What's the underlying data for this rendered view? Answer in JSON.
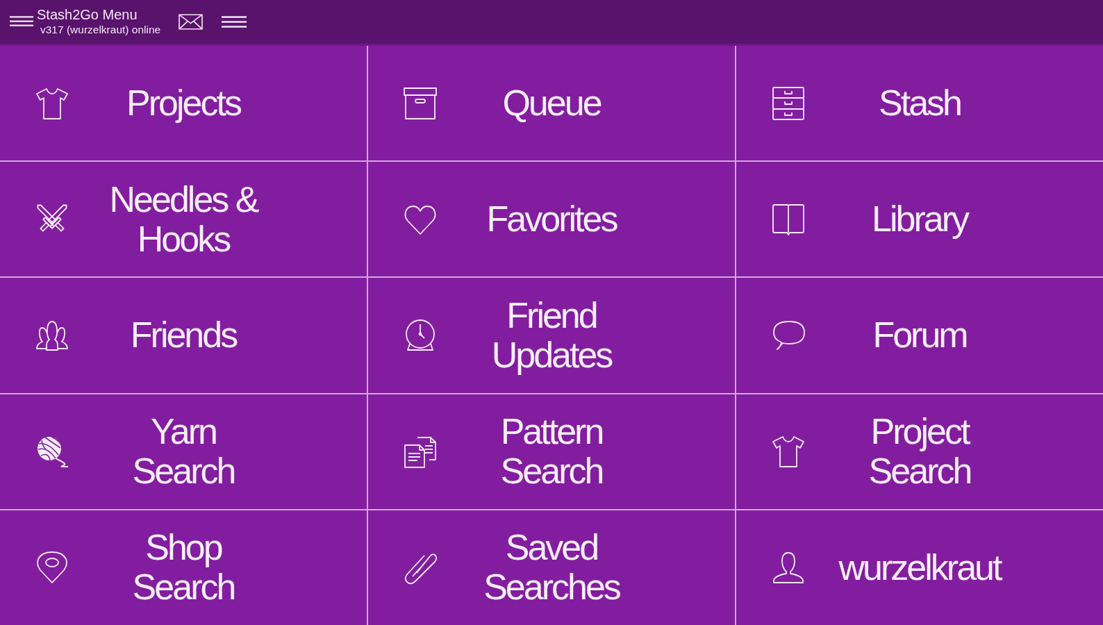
{
  "header": {
    "title": "Stash2Go Menu",
    "subtitle": "v317 (wurzelkraut) online"
  },
  "tiles": [
    {
      "label": "Projects",
      "kind": "shirt"
    },
    {
      "label": "Queue",
      "kind": "box"
    },
    {
      "label": "Stash",
      "kind": "drawers"
    },
    {
      "label": "Needles &\nHooks",
      "kind": "needles"
    },
    {
      "label": "Favorites",
      "kind": "heart"
    },
    {
      "label": "Library",
      "kind": "book"
    },
    {
      "label": "Friends",
      "kind": "people"
    },
    {
      "label": "Friend\nUpdates",
      "kind": "clock"
    },
    {
      "label": "Forum",
      "kind": "speech"
    },
    {
      "label": "Yarn\nSearch",
      "kind": "yarn"
    },
    {
      "label": "Pattern\nSearch",
      "kind": "pages"
    },
    {
      "label": "Project\nSearch",
      "kind": "shirt"
    },
    {
      "label": "Shop\nSearch",
      "kind": "pin"
    },
    {
      "label": "Saved\nSearches",
      "kind": "paperclip"
    },
    {
      "label": "wurzelkraut",
      "kind": "person"
    }
  ]
}
